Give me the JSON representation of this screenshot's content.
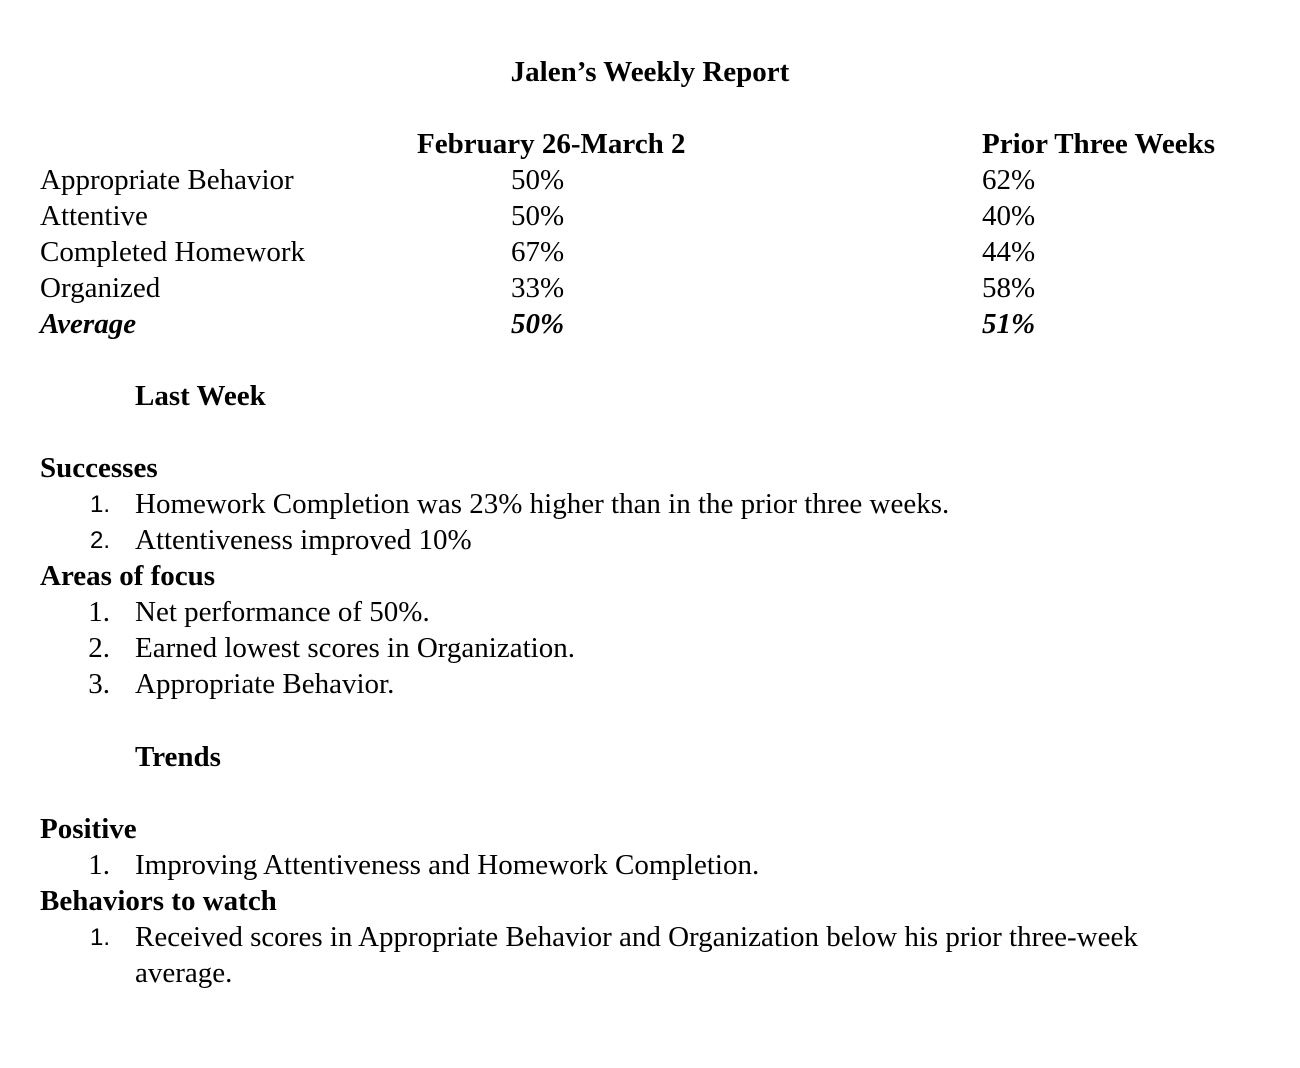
{
  "title": "Jalen’s Weekly Report",
  "table": {
    "col1_header": "February 26-March 2",
    "col2_header": "Prior Three Weeks",
    "rows": [
      {
        "label": "Appropriate Behavior",
        "current": "50%",
        "prior": "62%"
      },
      {
        "label": "Attentive",
        "current": "50%",
        "prior": "40%"
      },
      {
        "label": "Completed Homework",
        "current": "67%",
        "prior": "44%"
      },
      {
        "label": "Organized",
        "current": "33%",
        "prior": "58%"
      },
      {
        "label": "Average",
        "current": "50%",
        "prior": "51%"
      }
    ]
  },
  "last_week": {
    "heading": "Last Week",
    "successes": {
      "heading": "Successes",
      "items": [
        {
          "num": "1.",
          "text": "Homework Completion was 23% higher than in the prior three weeks."
        },
        {
          "num": "2.",
          "text": "Attentiveness improved 10%"
        }
      ]
    },
    "areas_of_focus": {
      "heading": "Areas of focus",
      "items": [
        {
          "num": "1.",
          "text": "Net performance of 50%."
        },
        {
          "num": "2.",
          "text": "Earned lowest scores in Organization."
        },
        {
          "num": "3.",
          "text": "Appropriate Behavior."
        }
      ]
    }
  },
  "trends": {
    "heading": "Trends",
    "positive": {
      "heading": "Positive",
      "items": [
        {
          "num": "1.",
          "text": "Improving Attentiveness and Homework Completion."
        }
      ]
    },
    "behaviors_to_watch": {
      "heading": "Behaviors to watch",
      "items": [
        {
          "num": "1.",
          "text_line1": "Received scores in Appropriate Behavior and Organization below his prior three-week",
          "text_line2": "average."
        }
      ]
    }
  }
}
